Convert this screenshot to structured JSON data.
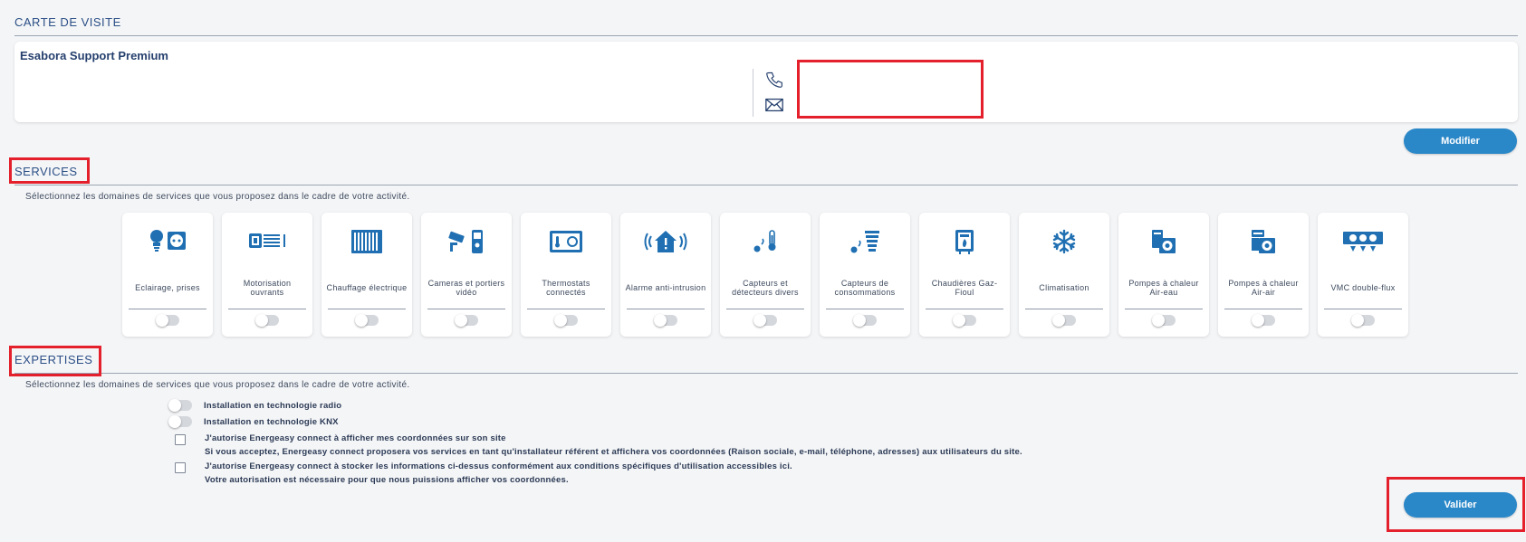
{
  "business_card": {
    "section_title": "CARTE DE VISITE",
    "company_name": "Esabora Support Premium",
    "phone_icon": "phone-icon",
    "email_icon": "envelope-icon",
    "edit_button": "Modifier"
  },
  "services": {
    "section_title": "SERVICES",
    "hint": "Sélectionnez les domaines de services que vous proposez dans le cadre de votre activité.",
    "items": [
      {
        "label": "Eclairage, prises",
        "icon": "lightbulb-socket-icon",
        "enabled": false
      },
      {
        "label": "Motorisation ouvrants",
        "icon": "motorized-shutter-icon",
        "enabled": false
      },
      {
        "label": "Chauffage électrique",
        "icon": "electric-radiator-icon",
        "enabled": false
      },
      {
        "label": "Cameras et portiers vidéo",
        "icon": "camera-intercom-icon",
        "enabled": false
      },
      {
        "label": "Thermostats connectés",
        "icon": "thermostat-icon",
        "enabled": false
      },
      {
        "label": "Alarme anti-intrusion",
        "icon": "alarm-house-icon",
        "enabled": false
      },
      {
        "label": "Capteurs et détecteurs divers",
        "icon": "sensor-thermometer-icon",
        "enabled": false
      },
      {
        "label": "Capteurs de consommations",
        "icon": "consumption-sensor-icon",
        "enabled": false
      },
      {
        "label": "Chaudières Gaz-Fioul",
        "icon": "boiler-icon",
        "enabled": false
      },
      {
        "label": "Climatisation",
        "icon": "snowflake-icon",
        "enabled": false
      },
      {
        "label": "Pompes à chaleur Air-eau",
        "icon": "heat-pump-water-icon",
        "enabled": false
      },
      {
        "label": "Pompes à chaleur Air-air",
        "icon": "heat-pump-air-icon",
        "enabled": false
      },
      {
        "label": "VMC double-flux",
        "icon": "ventilation-icon",
        "enabled": false
      }
    ]
  },
  "expertises": {
    "section_title": "EXPERTISES",
    "hint": "Sélectionnez les domaines de services que vous proposez dans le cadre de votre activité.",
    "toggles": [
      {
        "label": "Installation en technologie radio",
        "enabled": false
      },
      {
        "label": "Installation en technologie KNX",
        "enabled": false
      }
    ],
    "consents": [
      {
        "label": "J'autorise Energeasy connect à afficher mes coordonnées sur son site",
        "note": "Si vous acceptez, Energeasy connect proposera vos services en tant qu'installateur référent et affichera vos coordonnées (Raison sociale, e-mail, téléphone, adresses) aux utilisateurs du site.",
        "checked": false
      },
      {
        "label": "J'autorise Energeasy connect à stocker les informations ci-dessus conformément aux conditions spécifiques d'utilisation accessibles ici.",
        "note": "Votre autorisation est nécessaire pour que nous puissions afficher vos coordonnées.",
        "checked": false
      }
    ],
    "submit_button": "Valider"
  },
  "colors": {
    "accent": "#2b88c8",
    "icon_blue": "#1f6fb2",
    "highlight_red": "#e3202c",
    "background": "#f4f5f7"
  }
}
